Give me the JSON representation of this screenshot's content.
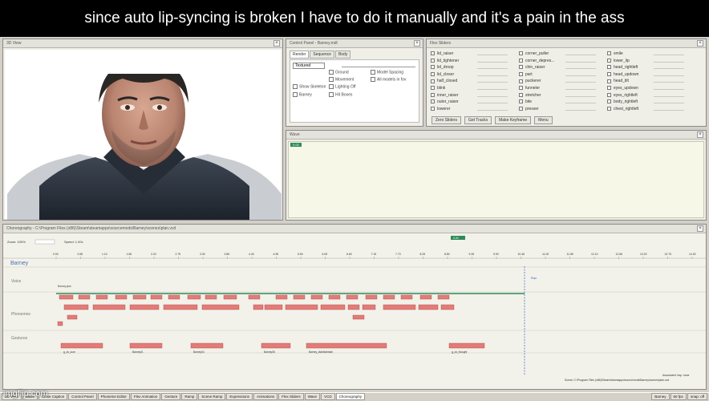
{
  "caption": "since auto lip-syncing is broken I have to do it manually and it's a pain in the ass",
  "view3d": {
    "title": "3D View"
  },
  "control_panel": {
    "title": "Control Panel - Barney.mdl",
    "tabs": [
      "Render",
      "Sequence",
      "Body"
    ],
    "select_value": "Textured",
    "checks_left": [
      "Show Skeleton",
      "Barney"
    ],
    "checks_mid": [
      "Ground",
      "Movement",
      "Lighting Off",
      "Hit Boxes"
    ],
    "slider_label": "Model Spacing",
    "check_right": "All models in fov"
  },
  "flex_sliders": {
    "title": "Flex Sliders",
    "col1": [
      "lid_raiser",
      "lid_tightener",
      "lid_droop",
      "lid_closer",
      "half_closed",
      "blink",
      "inner_raiser",
      "outer_raiser",
      "lowerer"
    ],
    "col2": [
      "corner_puller",
      "corner_depres...",
      "chin_raiser",
      "part",
      "puckerer",
      "funneler",
      "stretcher",
      "bite",
      "presser"
    ],
    "col3": [
      "smile",
      "lower_lip",
      "head_rightleft",
      "head_updown",
      "head_tilt",
      "eyes_updown",
      "eyes_rightleft",
      "body_rightleft",
      "chest_rightleft"
    ],
    "buttons": [
      "Zero Sliders",
      "Get Tracks",
      "Make Keyframe",
      "Menu"
    ]
  },
  "wave": {
    "title": "Wave",
    "label": "0.00"
  },
  "choreo": {
    "title": "Choreography - C:\\Program Files (x86)\\Steam\\steamapps\\sourcemods\\Barney\\scenes\\plan.vcd",
    "zoom_text": "Zoom: 100%",
    "speed_text": "Speed: 1.00x",
    "actor": "Barney",
    "rows": [
      "Voice",
      "Phonemes",
      "Gestures"
    ],
    "ticks": [
      "0.00",
      "0.55",
      "1.10",
      "1.65",
      "2.20",
      "2.75",
      "3.30",
      "3.85",
      "4.40",
      "4.95",
      "5.50",
      "6.05",
      "6.60",
      "7.15",
      "7.70",
      "8.25",
      "8.80",
      "9.35",
      "9.90",
      "10.45",
      "11.00",
      "11.55",
      "12.10",
      "12.65",
      "13.20",
      "13.75",
      "14.30"
    ],
    "play_marker": "0.00",
    "voice_event": "Barney.plan",
    "end_marker": "Plan",
    "gestures": [
      "g_ok_sure",
      "Barney01",
      "Barney04",
      "Barney08",
      "Barney_blahblahblah",
      "g_ok_thought"
    ],
    "footer_left": "Associated .bsp: none",
    "footer_right": "Scene: C:\\Program Files (x86)\\Steam\\steamapps\\sourcemods\\Barney\\scenes\\plan.vcd"
  },
  "taskbar": {
    "tabs": [
      "3D View",
      "Wave",
      "Close Caption",
      "Control Panel",
      "Phoneme Editor",
      "Flex Animation",
      "Gesture",
      "Ramp",
      "Scene Ramp",
      "Expressions",
      "Animations",
      "Flex Sliders",
      "Wave",
      "VCD",
      "Choreography"
    ],
    "right": [
      "Barney",
      "60 fps",
      "snap: off"
    ]
  },
  "watermark": "imgflip.com",
  "colors": {
    "event": "#e37b78",
    "event_border": "#b14a48",
    "wave_line": "#2e8b57",
    "playhead": "#2f5fcf",
    "accent_green": "#2e8b57"
  }
}
